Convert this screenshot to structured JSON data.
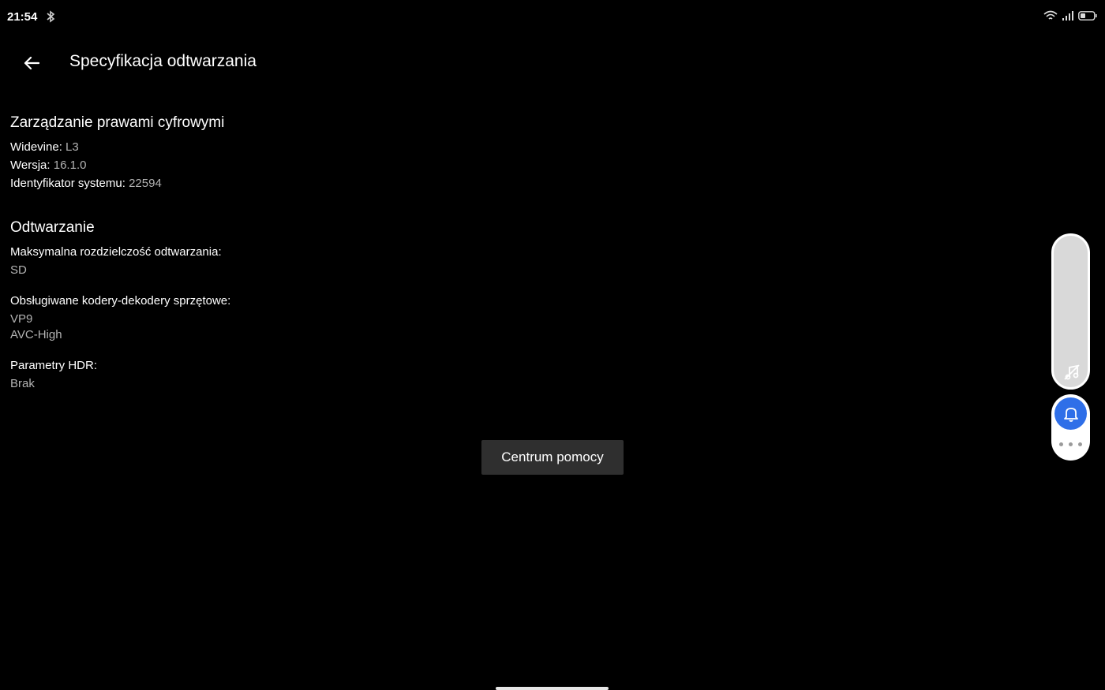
{
  "status_bar": {
    "time": "21:54",
    "icons": [
      "bluetooth-icon",
      "wifi-icon",
      "signal-icon",
      "battery-icon"
    ]
  },
  "header": {
    "back_icon": "arrow-left-icon",
    "title": "Specyfikacja odtwarzania"
  },
  "drm": {
    "title": "Zarządzanie prawami cyfrowymi",
    "widevine_label": "Widevine:",
    "widevine_value": "L3",
    "version_label": "Wersja:",
    "version_value": "16.1.0",
    "system_id_label": "Identyfikator systemu:",
    "system_id_value": "22594"
  },
  "playback": {
    "title": "Odtwarzanie",
    "max_resolution_label": "Maksymalna rozdzielczość odtwarzania:",
    "max_resolution_value": "SD",
    "codecs_label": "Obsługiwane kodery-dekodery sprzętowe:",
    "codecs": [
      "VP9",
      "AVC-High"
    ],
    "hdr_label": "Parametry HDR:",
    "hdr_value": "Brak"
  },
  "help_button": "Centrum pomocy",
  "side_panel": {
    "pill_icon": "music-off-icon",
    "bell_icon": "bell-icon",
    "more_icon": "more-dots-icon",
    "accent_color": "#2f6fe8"
  }
}
